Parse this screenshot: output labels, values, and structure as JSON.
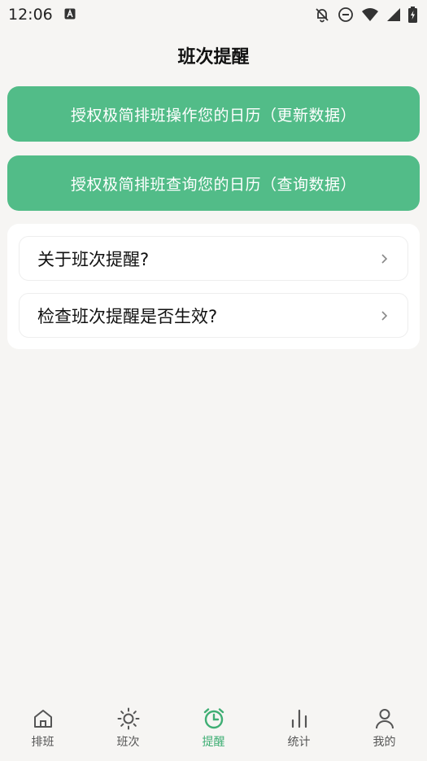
{
  "status_bar": {
    "time": "12:06",
    "icons": [
      "font-a-icon",
      "bell-off-icon",
      "do-not-disturb-icon",
      "wifi-icon",
      "signal-icon",
      "battery-charging-icon"
    ]
  },
  "header": {
    "title": "班次提醒"
  },
  "actions": {
    "authorize_write": "授权极简排班操作您的日历（更新数据）",
    "authorize_read": "授权极简排班查询您的日历（查询数据）"
  },
  "list": {
    "items": [
      {
        "label": "关于班次提醒?"
      },
      {
        "label": "检查班次提醒是否生效?"
      }
    ]
  },
  "tabs": [
    {
      "label": "排班",
      "icon": "home-icon",
      "active": false
    },
    {
      "label": "班次",
      "icon": "sun-icon",
      "active": false
    },
    {
      "label": "提醒",
      "icon": "alarm-clock-icon",
      "active": true
    },
    {
      "label": "统计",
      "icon": "bar-chart-icon",
      "active": false
    },
    {
      "label": "我的",
      "icon": "person-icon",
      "active": false
    }
  ],
  "colors": {
    "accent": "#52bc88",
    "active_tab": "#3fae74",
    "background": "#f6f5f3"
  }
}
